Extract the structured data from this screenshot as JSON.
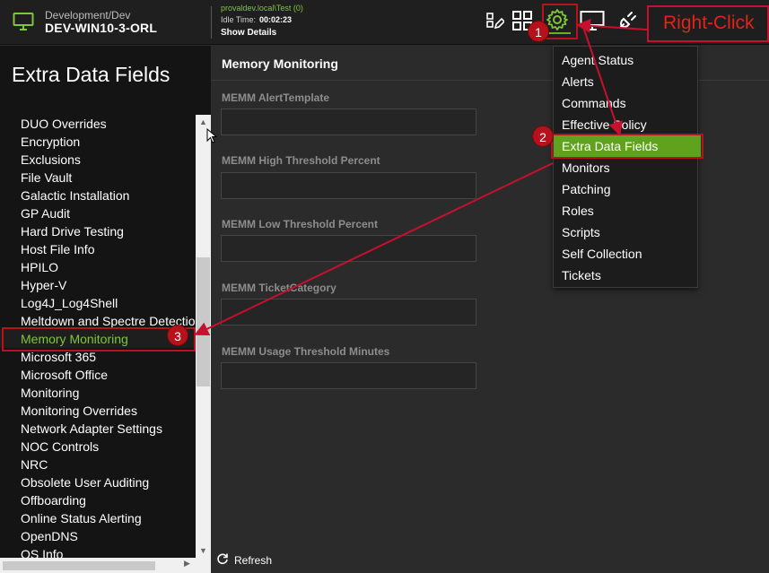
{
  "topbar": {
    "env_path": "Development/Dev",
    "device_name": "DEV-WIN10-3-ORL",
    "session_user": "provaldev.local\\Test (0)",
    "idle_label": "Idle Time:",
    "idle_value": "00:02:23",
    "show_details": "Show Details",
    "accent_color": "#7ec63a"
  },
  "left_panel": {
    "title": "Extra Data Fields",
    "items": [
      {
        "label": "DUO Overrides"
      },
      {
        "label": "Encryption"
      },
      {
        "label": "Exclusions"
      },
      {
        "label": "File Vault"
      },
      {
        "label": "Galactic Installation"
      },
      {
        "label": "GP Audit"
      },
      {
        "label": "Hard Drive Testing"
      },
      {
        "label": "Host File Info"
      },
      {
        "label": "HPILO"
      },
      {
        "label": "Hyper-V"
      },
      {
        "label": "Log4J_Log4Shell"
      },
      {
        "label": "Meltdown and Spectre Detection"
      },
      {
        "label": "Memory Monitoring",
        "active": true
      },
      {
        "label": "Microsoft 365"
      },
      {
        "label": "Microsoft Office"
      },
      {
        "label": "Monitoring"
      },
      {
        "label": "Monitoring Overrides"
      },
      {
        "label": "Network Adapter Settings"
      },
      {
        "label": "NOC Controls"
      },
      {
        "label": "NRC"
      },
      {
        "label": "Obsolete User Auditing"
      },
      {
        "label": "Offboarding"
      },
      {
        "label": "Online Status Alerting"
      },
      {
        "label": "OpenDNS"
      },
      {
        "label": "OS Info"
      }
    ]
  },
  "main": {
    "title": "Memory Monitoring",
    "fields": [
      {
        "label": "MEMM AlertTemplate",
        "value": ""
      },
      {
        "label": "MEMM High Threshold Percent",
        "value": ""
      },
      {
        "label": "MEMM Low Threshold Percent",
        "value": ""
      },
      {
        "label": "MEMM TicketCategory",
        "value": ""
      },
      {
        "label": "MEMM Usage Threshold Minutes",
        "value": ""
      }
    ],
    "refresh_label": "Refresh"
  },
  "menu": {
    "items": [
      {
        "label": "Agent Status"
      },
      {
        "label": "Alerts"
      },
      {
        "label": "Commands"
      },
      {
        "label": "Effective Policy"
      },
      {
        "label": "Extra Data Fields",
        "highlight": true
      },
      {
        "label": "Monitors"
      },
      {
        "label": "Patching"
      },
      {
        "label": "Roles"
      },
      {
        "label": "Scripts"
      },
      {
        "label": "Self Collection"
      },
      {
        "label": "Tickets"
      }
    ],
    "highlight_color": "#5ea21e"
  },
  "annotations": {
    "right_click_label": "Right-Click",
    "step1": "1",
    "step2": "2",
    "step3": "3",
    "annotation_color": "#c8102e"
  }
}
